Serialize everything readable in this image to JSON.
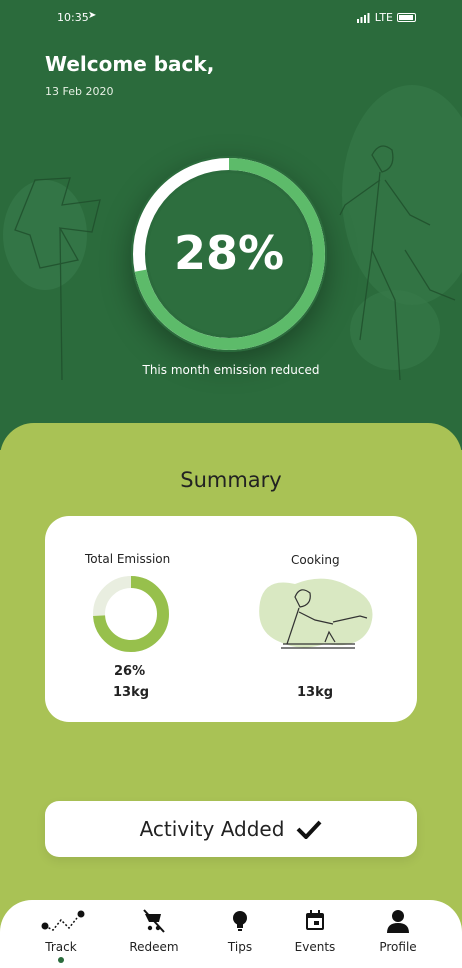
{
  "status": {
    "time": "10:35",
    "network": "LTE"
  },
  "header": {
    "title": "Welcome back,",
    "date": "13 Feb 2020"
  },
  "progress": {
    "percent_label": "28%",
    "value": 0.28,
    "caption": "This month emission reduced"
  },
  "summary": {
    "title": "Summary",
    "total": {
      "label": "Total Emission",
      "percent_label": "26%",
      "value": 0.26,
      "amount": "13kg"
    },
    "cooking": {
      "label": "Cooking",
      "amount": "13kg"
    }
  },
  "activity": {
    "label": "Activity Added"
  },
  "nav": {
    "items": [
      {
        "label": "Track",
        "icon": "route-icon"
      },
      {
        "label": "Redeem",
        "icon": "cart-off-icon"
      },
      {
        "label": "Tips",
        "icon": "lightbulb-icon"
      },
      {
        "label": "Events",
        "icon": "calendar-icon"
      },
      {
        "label": "Profile",
        "icon": "person-icon"
      }
    ],
    "active_index": 0
  },
  "colors": {
    "dark_green": "#2b6b3c",
    "light_green": "#a9c255",
    "ring_green": "#5dbb6a",
    "donut_green": "#97c04c"
  }
}
